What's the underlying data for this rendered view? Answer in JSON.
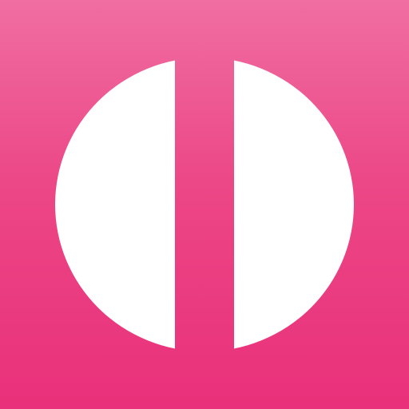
{
  "icon": {
    "name": "split-circle-logo-icon",
    "colors": {
      "background_top": "#f06ea2",
      "background_mid": "#ec4786",
      "background_bottom": "#e9307a",
      "mark": "#ffffff"
    }
  }
}
